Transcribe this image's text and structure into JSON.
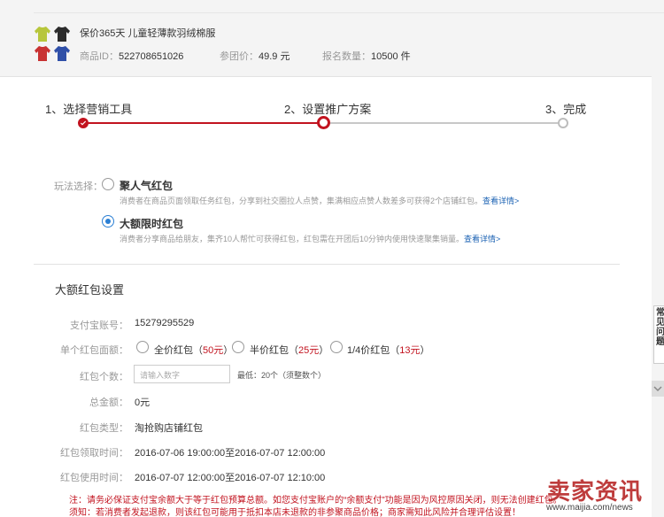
{
  "product": {
    "name": "保价365天 儿童轻薄款羽绒棉服",
    "id_label": "商品ID：",
    "id_value": "522708651026",
    "price_label": "参团价：",
    "price_value": "49.9 元",
    "enroll_label": "报名数量：",
    "enroll_value": "10500 件",
    "image_colors": [
      "#b7c63b",
      "#2b2b2b",
      "#c83232",
      "#2f4fa8"
    ]
  },
  "steps": [
    {
      "label": "1、选择营销工具",
      "state": "done"
    },
    {
      "label": "2、设置推广方案",
      "state": "current"
    },
    {
      "label": "3、完成",
      "state": "todo"
    }
  ],
  "play": {
    "label": "玩法选择：",
    "options": [
      {
        "title": "聚人气红包",
        "desc": "消费者在商品页面领取任务红包，分享到社交圈拉人点赞，集满相应点赞人数差多可获得2个店铺红包。",
        "link": "查看详情>",
        "selected": false
      },
      {
        "title": "大额限时红包",
        "desc": "消费者分享商品给朋友，集齐10人帮忙可获得红包，红包需在开团后10分钟内使用快速聚集销量。",
        "link": "查看详情>",
        "selected": true
      }
    ]
  },
  "settings": {
    "title": "大额红包设置",
    "alipay_label": "支付宝账号：",
    "alipay_value": "15279295529",
    "face_label": "单个红包面额：",
    "face_options": [
      {
        "name": "全价红包",
        "amount": "50元",
        "pre": "（",
        "post": "）"
      },
      {
        "name": "半价红包",
        "amount": "25元",
        "pre": "（",
        "post": "）"
      },
      {
        "name": "1/4价红包",
        "amount": "13元",
        "pre": "（",
        "post": "）"
      }
    ],
    "count_label": "红包个数：",
    "count_placeholder": "请输入数字",
    "count_hint": "最低：20个（须整数个）",
    "total_label": "总金额：",
    "total_value": "0元",
    "type_label": "红包类型：",
    "type_value": "淘抢购店铺红包",
    "claim_label": "红包领取时间：",
    "claim_value": "2016-07-06 19:00:00至2016-07-07 12:00:00",
    "use_label": "红包使用时间：",
    "use_value": "2016-07-07 12:00:00至2016-07-07 12:10:00"
  },
  "notice": {
    "line1": "注：请务必保证支付宝余额大于等于红包预算总额。如您支付宝账户的“余额支付”功能是因为风控原因关闭，则无法创建红包。",
    "line2": "须知：若消费者发起退款，则该红包可能用于抵扣本店未退款的非参聚商品价格；商家需知此风险并合理评估设置！"
  },
  "side_tab": "常见问题",
  "watermark": {
    "brand": "卖家资讯",
    "url": "www.maijia.com/news"
  }
}
